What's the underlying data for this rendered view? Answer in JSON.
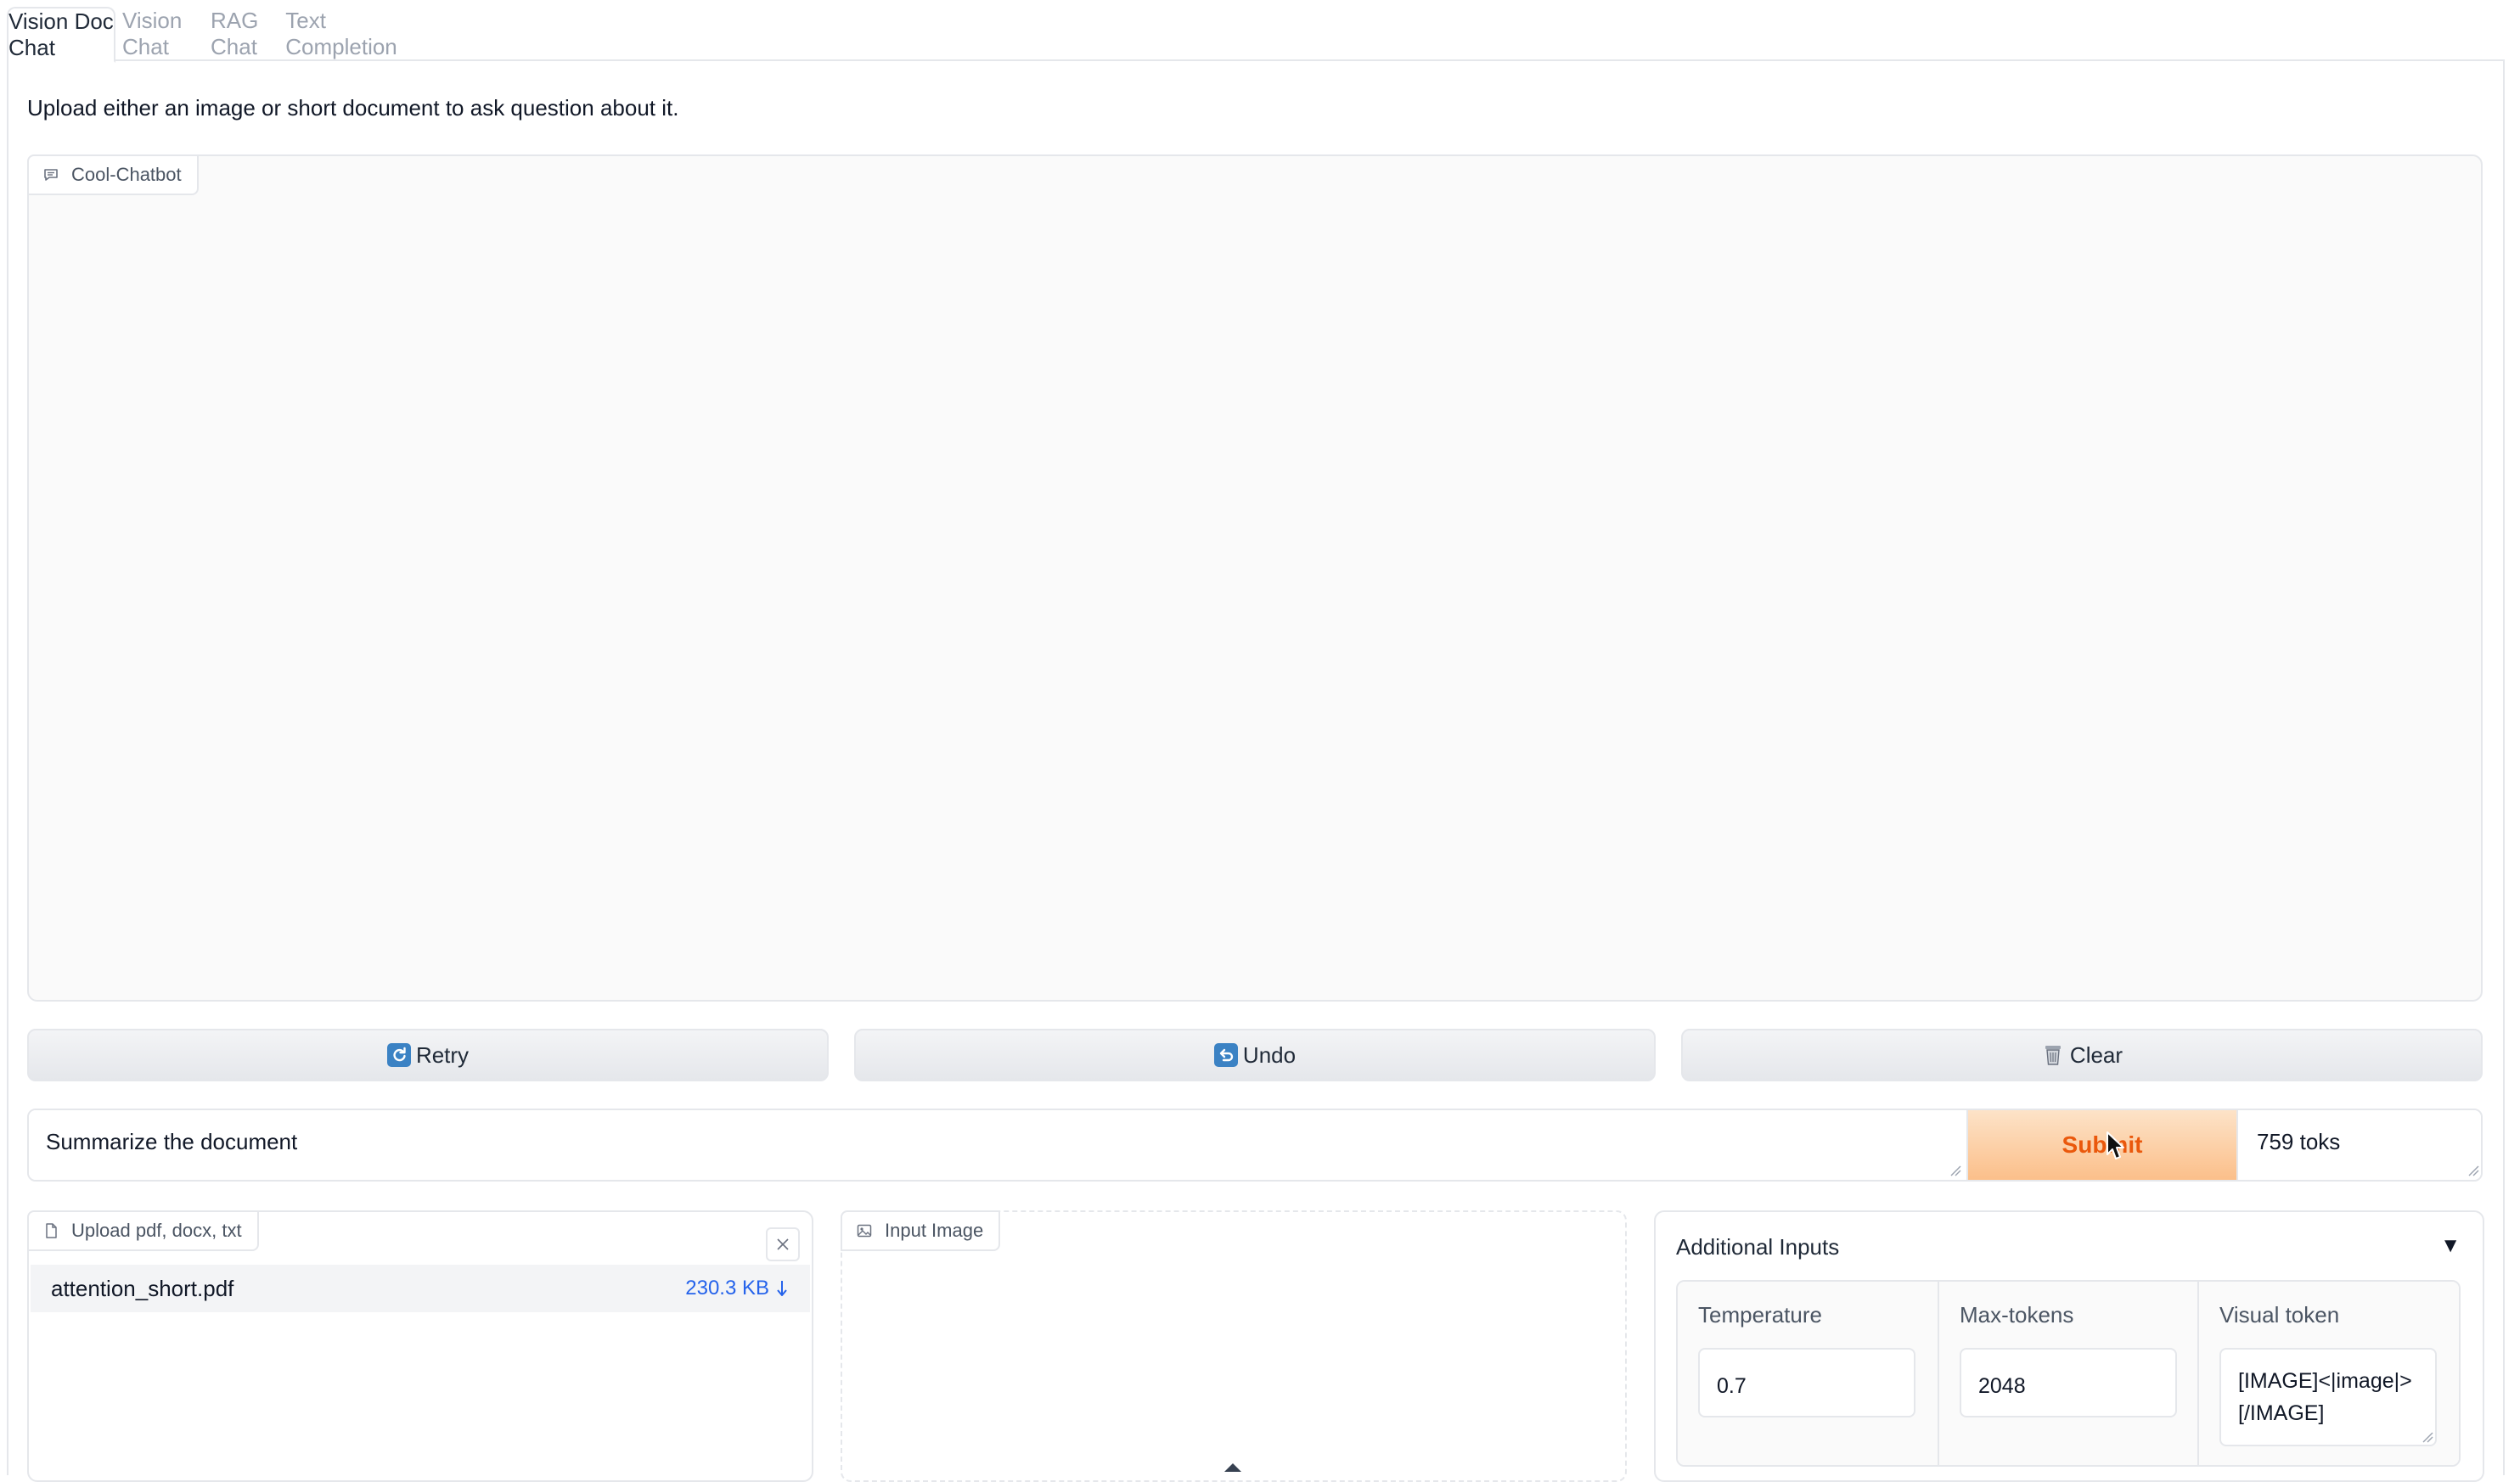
{
  "tabs": [
    {
      "label": "Vision Doc Chat",
      "active": true
    },
    {
      "label": "Vision Chat",
      "active": false
    },
    {
      "label": "RAG Chat",
      "active": false
    },
    {
      "label": "Text Completion",
      "active": false
    }
  ],
  "description": "Upload either an image or short document to ask question about it.",
  "chatbot": {
    "label": "Cool-Chatbot",
    "icon": "chat-bubble-icon"
  },
  "actions": {
    "retry_label": "Retry",
    "undo_label": "Undo",
    "clear_label": "Clear"
  },
  "input": {
    "value": "Summarize the document",
    "submit_label": "Submit",
    "token_count": "759 toks"
  },
  "file_upload": {
    "label": "Upload pdf, docx, txt",
    "icon": "file-icon",
    "file_name": "attention_short.pdf",
    "file_size": "230.3 KB",
    "download_icon": "download-arrow-icon"
  },
  "image_input": {
    "label": "Input Image",
    "icon": "image-icon"
  },
  "additional": {
    "title": "Additional Inputs",
    "toggle_glyph": "▼",
    "temperature_label": "Temperature",
    "temperature_value": "0.7",
    "max_tokens_label": "Max-tokens",
    "max_tokens_value": "2048",
    "visual_token_label": "Visual token",
    "visual_token_value_line1": "[IMAGE]<|image|>",
    "visual_token_value_line2": "[/IMAGE]"
  },
  "colors": {
    "submit_text": "#ea580c",
    "submit_bg": "#fbbf8a",
    "link": "#2563eb"
  }
}
